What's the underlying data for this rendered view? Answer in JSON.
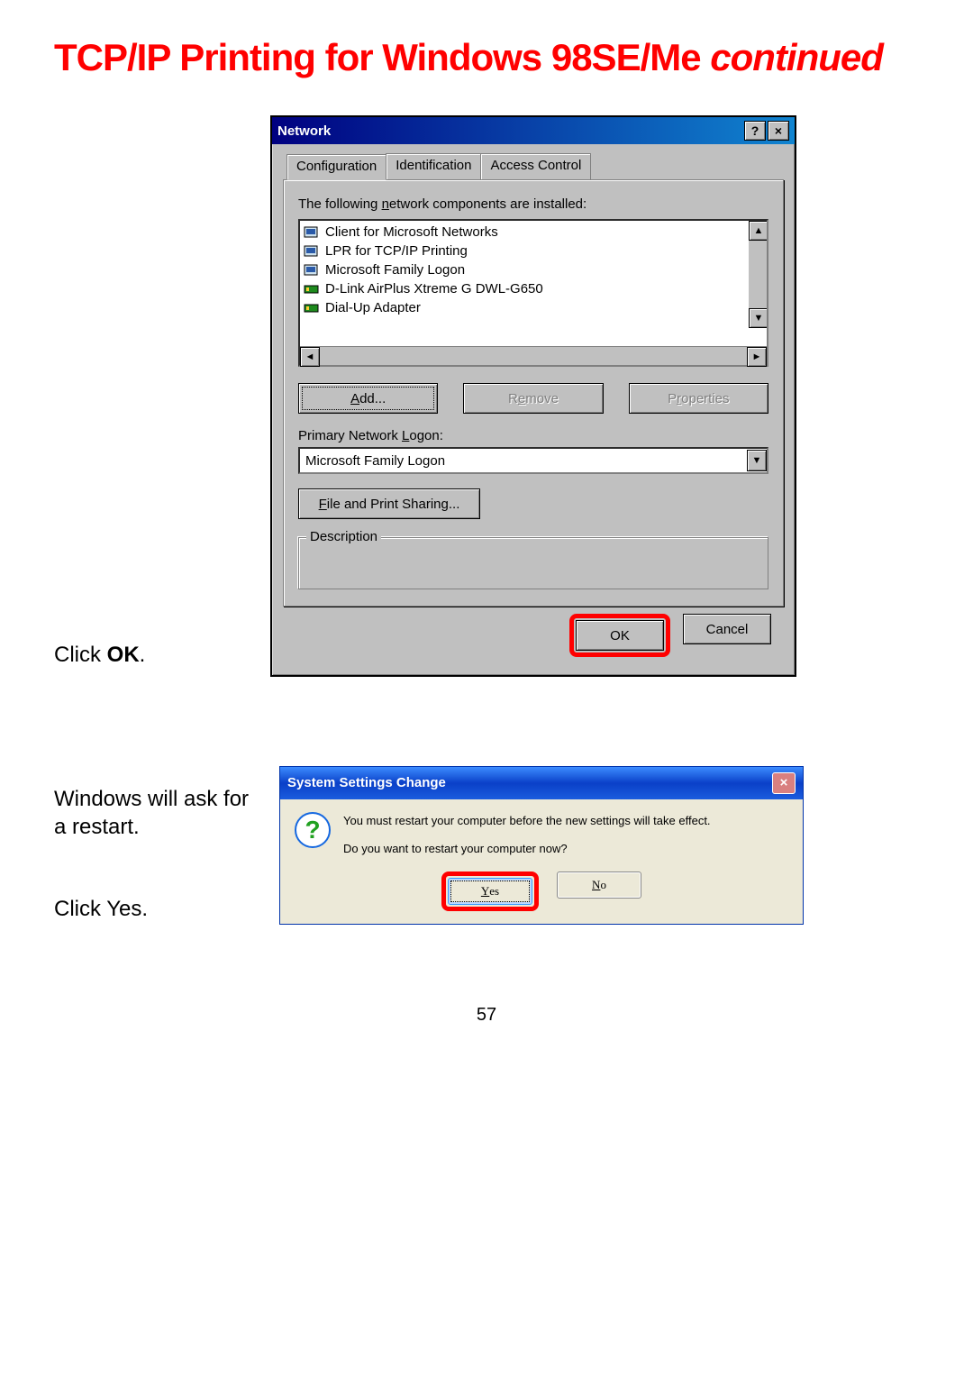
{
  "heading": {
    "main": "TCP/IP Printing for Windows 98SE/Me",
    "continued": "continued"
  },
  "caption1_pre": "Click ",
  "caption1_bold": "OK",
  "caption1_post": ".",
  "caption2a": "Windows will ask for a restart.",
  "caption2b_pre": "Click ",
  "caption2b_bold": "Yes",
  "caption2b_post": ".",
  "dialog98": {
    "title": "Network",
    "help_glyph": "?",
    "close_glyph": "×",
    "tabs": [
      "Configuration",
      "Identification",
      "Access Control"
    ],
    "list_label_pre": "The following ",
    "list_label_u": "n",
    "list_label_post": "etwork components are installed:",
    "items": [
      {
        "icon": "client",
        "label": "Client for Microsoft Networks"
      },
      {
        "icon": "client",
        "label": "LPR for TCP/IP Printing"
      },
      {
        "icon": "client",
        "label": "Microsoft Family Logon"
      },
      {
        "icon": "adapter",
        "label": "D-Link AirPlus Xtreme G DWL-G650"
      },
      {
        "icon": "adapter",
        "label": "Dial-Up Adapter"
      }
    ],
    "buttons": {
      "add_u": "A",
      "add_rest": "dd...",
      "remove_pre": "R",
      "remove_u": "e",
      "remove_post": "move",
      "props_pre": "P",
      "props_u": "r",
      "props_post": "operties"
    },
    "primary_label_pre": "Primary Network ",
    "primary_label_u": "L",
    "primary_label_post": "ogon:",
    "primary_value": "Microsoft Family Logon",
    "share_btn_u": "F",
    "share_btn_rest": "ile and Print Sharing...",
    "description_legend": "Description",
    "ok": "OK",
    "cancel": "Cancel"
  },
  "dialogxp": {
    "title": "System Settings Change",
    "line1": "You must restart your computer before the new settings will take effect.",
    "line2": "Do you want to restart your computer now?",
    "yes_u": "Y",
    "yes_rest": "es",
    "no_u": "N",
    "no_rest": "o"
  },
  "page_number": "57"
}
